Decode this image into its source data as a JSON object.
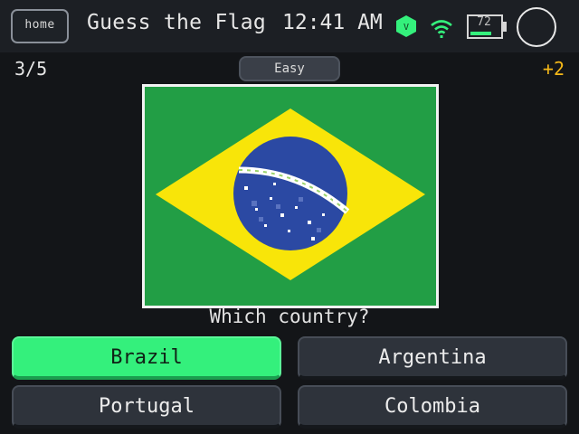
{
  "header": {
    "home_label": "home",
    "title": "Guess the Flag",
    "clock": "12:41 AM",
    "vpn_badge": "V",
    "battery_level": "72",
    "accent_color": "#34f07c"
  },
  "status": {
    "progress": "3/5",
    "difficulty": "Easy",
    "score_delta": "+2"
  },
  "flag": {
    "icon": "flag-brazil",
    "colors": {
      "green": "#229e45",
      "yellow": "#f8e509",
      "blue": "#2b49a3",
      "white": "#ffffff"
    }
  },
  "question": "Which country?",
  "answers": [
    {
      "label": "Brazil",
      "selected": true
    },
    {
      "label": "Argentina",
      "selected": false
    },
    {
      "label": "Portugal",
      "selected": false
    },
    {
      "label": "Colombia",
      "selected": false
    }
  ]
}
